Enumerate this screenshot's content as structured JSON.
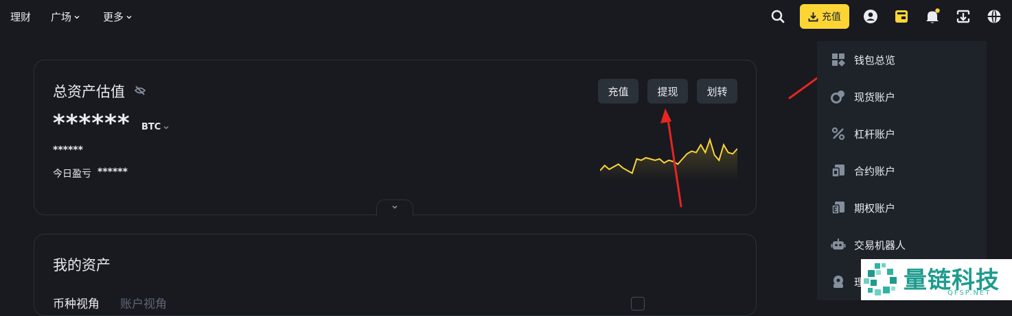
{
  "nav": {
    "items": [
      {
        "label": "理财"
      },
      {
        "label": "广场"
      },
      {
        "label": "更多"
      }
    ]
  },
  "header": {
    "deposit_label": "充值",
    "icons": [
      "search-icon",
      "download-icon",
      "user-icon",
      "wallet-icon",
      "bell-icon",
      "transfer-icon",
      "globe-icon"
    ],
    "accent_color": "#fcd535"
  },
  "overview": {
    "title": "总资产估值",
    "hidden_balance": "******",
    "currency": "BTC",
    "fiat_hidden": "******",
    "pnl_label": "今日盈亏",
    "pnl_value": "******",
    "buttons": [
      "充值",
      "提现",
      "划转"
    ],
    "sparkline": [
      38,
      42,
      39,
      41,
      43,
      40,
      38,
      36,
      47,
      46,
      48,
      47,
      46,
      47,
      44,
      46,
      45,
      43,
      47,
      51,
      53,
      52,
      58,
      52,
      62,
      50,
      46,
      58,
      52,
      51,
      55
    ]
  },
  "assets": {
    "title": "我的资产",
    "partial_tab_1": "币种视角",
    "partial_tab_2": "账户视角"
  },
  "dropdown": {
    "items": [
      {
        "label": "钱包总览",
        "icon": "grid-icon"
      },
      {
        "label": "现货账户",
        "icon": "spot-icon"
      },
      {
        "label": "杠杆账户",
        "icon": "percent-icon"
      },
      {
        "label": "合约账户",
        "icon": "futures-icon"
      },
      {
        "label": "期权账户",
        "icon": "options-icon"
      },
      {
        "label": "交易机器人",
        "icon": "robot-icon"
      },
      {
        "label": "理财账户",
        "icon": "earn-icon"
      }
    ]
  },
  "watermark": {
    "brand": "量链科技",
    "domain": "QFSP.NET"
  }
}
